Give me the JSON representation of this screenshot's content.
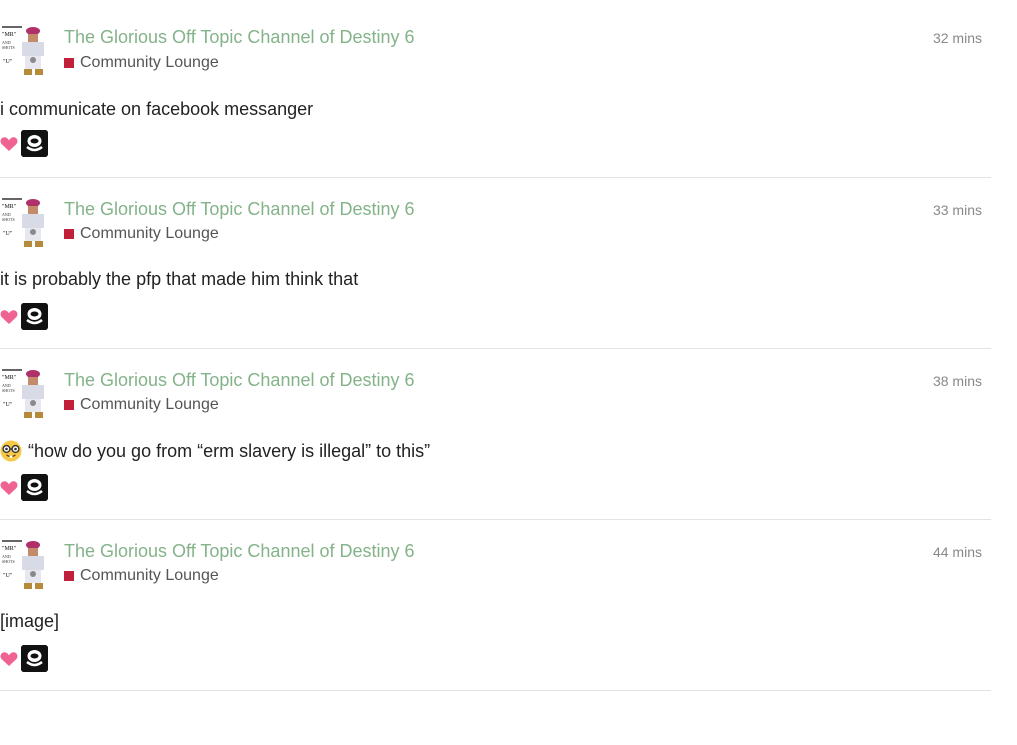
{
  "posts": [
    {
      "topic_title": "The Glorious Off Topic Channel of Destiny 6",
      "category": "Community Lounge",
      "time": "32 mins",
      "excerpt": "i communicate on facebook messanger",
      "has_nerd_emoji": false
    },
    {
      "topic_title": "The Glorious Off Topic Channel of Destiny 6",
      "category": "Community Lounge",
      "time": "33 mins",
      "excerpt": "it is probably the pfp that made him think that",
      "has_nerd_emoji": false
    },
    {
      "topic_title": "The Glorious Off Topic Channel of Destiny 6",
      "category": "Community Lounge",
      "time": "38 mins",
      "excerpt": "“how do you go from “erm slavery is illegal” to this”",
      "has_nerd_emoji": true
    },
    {
      "topic_title": "The Glorious Off Topic Channel of Destiny 6",
      "category": "Community Lounge",
      "time": "44 mins",
      "excerpt": "[image]",
      "has_nerd_emoji": false
    }
  ],
  "colors": {
    "topic_title": "#84b38a",
    "category_swatch": "#c0203a",
    "heart": "#f06292",
    "divider": "#e3e3e3"
  },
  "icons": {
    "like": "heart-icon",
    "nerd": "nerd-face-emoji"
  }
}
